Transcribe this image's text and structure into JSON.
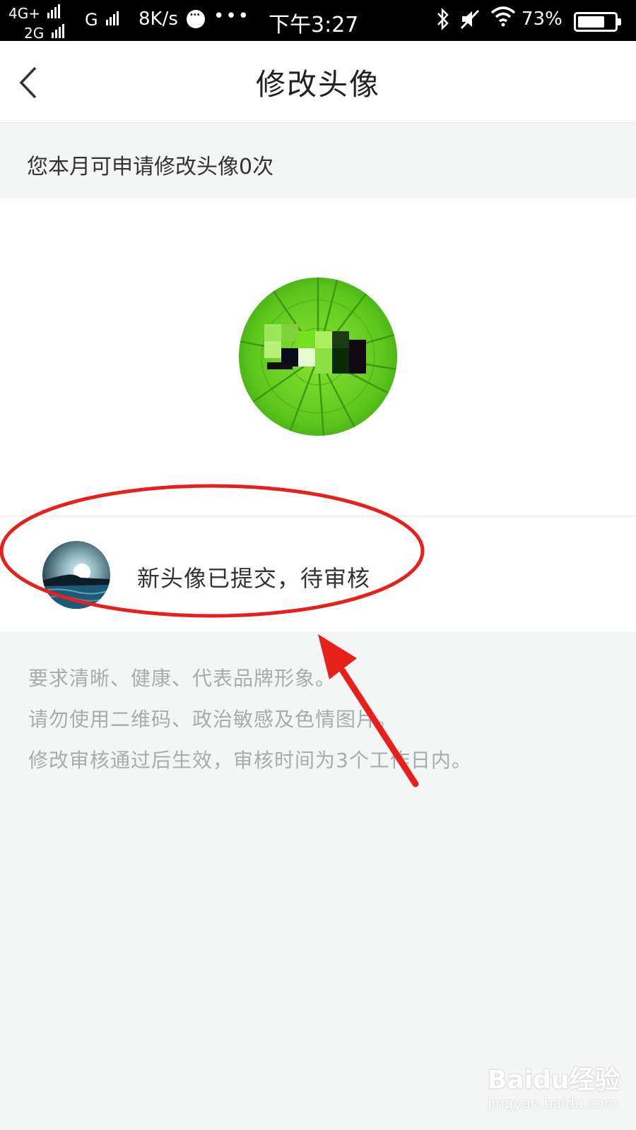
{
  "status_bar": {
    "network_top": "4G+",
    "network_bottom": "2G",
    "network_g": "G",
    "speed": "8K/s",
    "dots": "•••",
    "time": "下午3:27",
    "battery": "73%",
    "battery_level": 0.73
  },
  "nav": {
    "title": "修改头像",
    "back_icon": "chevron-left-icon"
  },
  "quota": {
    "text": "您本月可申请修改头像0次"
  },
  "pending": {
    "text": "新头像已提交，待审核"
  },
  "requirements": [
    "要求清晰、健康、代表品牌形象。",
    "请勿使用二维码、政治敏感及色情图片。",
    "修改审核通过后生效，审核时间为3个工作日内。"
  ],
  "watermark": {
    "main": "Baidu经验",
    "sub": "jingyan.baidu.com"
  },
  "colors": {
    "annotation_red": "#e8201c",
    "background": "#f4f6f6"
  }
}
